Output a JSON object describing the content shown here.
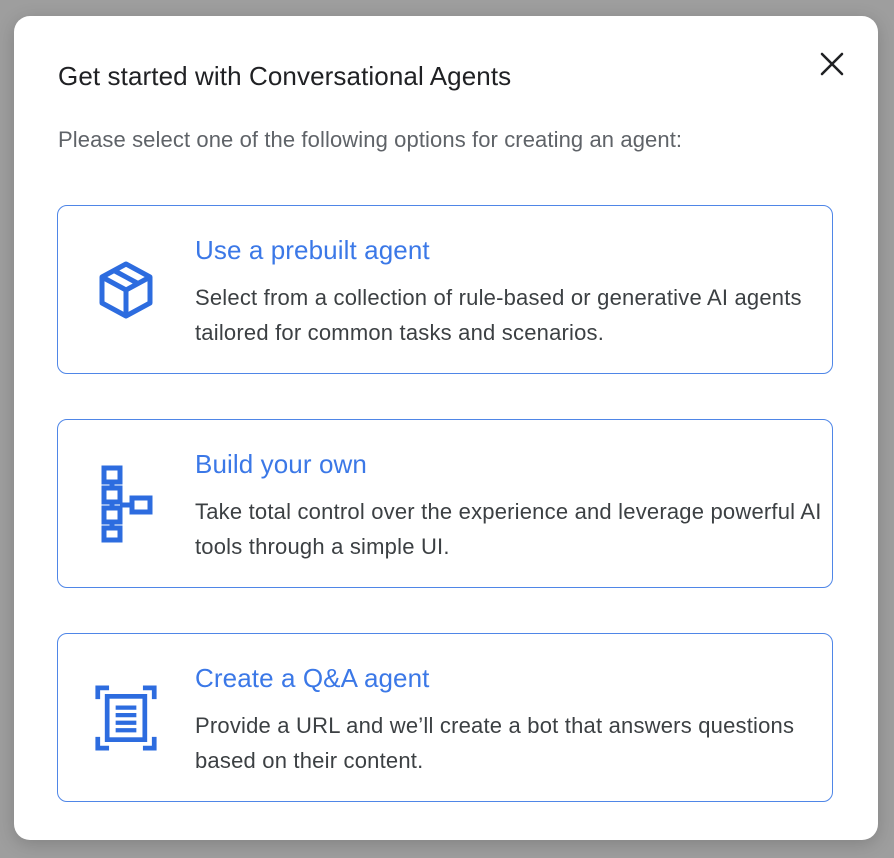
{
  "dialog": {
    "title": "Get started with Conversational Agents",
    "subtitle": "Please select one of the following options for creating an agent:",
    "close_icon": "close-icon"
  },
  "options": [
    {
      "icon": "cube-icon",
      "title": "Use a prebuilt agent",
      "description": "Select from a collection of rule-based or generative AI agents tailored for common tasks and scenarios."
    },
    {
      "icon": "flow-diagram-icon",
      "title": "Build your own",
      "description": "Take total control over the experience and leverage powerful AI tools through a simple UI."
    },
    {
      "icon": "document-scan-icon",
      "title": "Create a Q&A agent",
      "description": "Provide a URL and we’ll create a bot that answers questions based on their content."
    }
  ],
  "colors": {
    "accent": "#3b78e7",
    "border": "#4f86e7",
    "icon": "#2d6cdf",
    "title_text": "#202124",
    "subtitle_text": "#5f6368",
    "body_text": "#3c4043",
    "backdrop": "#9e9e9e"
  }
}
